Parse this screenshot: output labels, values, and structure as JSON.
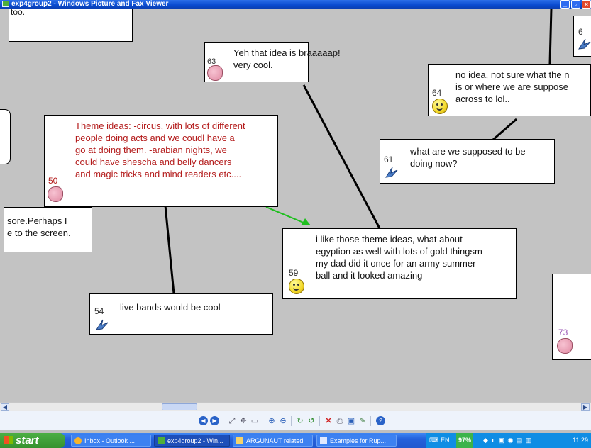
{
  "window": {
    "title": "exp4group2 - Windows Picture and Fax Viewer",
    "buttons": [
      "minimize",
      "maximize",
      "close"
    ]
  },
  "cards": {
    "c_top_left": {
      "text": "too."
    },
    "c63": {
      "num": "63",
      "text": "Yeh that idea is braaaaap!\nvery cool.",
      "icon": "elephant-icon"
    },
    "c64": {
      "num": "64",
      "text": "no idea, not sure what the n\nis or where we are suppose\nacross to lol..",
      "icon": "smiley-icon"
    },
    "c61": {
      "num": "61",
      "text": "what are we supposed to be\ndoing now?",
      "icon": "bird-icon"
    },
    "c50": {
      "num": "50",
      "text": "Theme ideas: -circus, with lots of different\npeople doing acts and we coudl have a\ngo at doing them. -arabian nights, we\ncould have shescha and belly dancers\nand magic tricks and mind readers etc....",
      "icon": "elephant-icon",
      "color": "#b41c1c"
    },
    "c_left": {
      "text": "sore.Perhaps I\ne to the screen."
    },
    "c59": {
      "num": "59",
      "text": "i like those theme ideas, what about\negyption as well with lots of gold thingsm\nmy dad did it once for an army summer\nball and it looked amazing",
      "icon": "smiley-icon"
    },
    "c54": {
      "num": "54",
      "text": "live bands would be cool",
      "icon": "bird-icon"
    },
    "c73": {
      "num": "73",
      "icon": "elephant-icon",
      "color": "#9b59b6"
    },
    "c6x": {
      "num": "6",
      "icon": "bird-icon"
    }
  },
  "arrow_color": "#1fbf1f",
  "taskbar": {
    "start": "start",
    "tasks": [
      {
        "label": "Inbox - Outlook ...",
        "icon": "outlook-icon"
      },
      {
        "label": "exp4group2 - Win...",
        "icon": "picture-viewer-icon",
        "active": true
      },
      {
        "label": "ARGUNAUT related",
        "icon": "folder-icon"
      },
      {
        "label": "Examples for Rup...",
        "icon": "document-icon"
      }
    ],
    "lang": "EN",
    "battery": "97%",
    "clock": "11:29"
  }
}
